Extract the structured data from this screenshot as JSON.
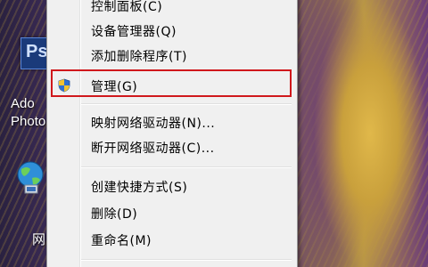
{
  "desktop": {
    "icons": [
      {
        "name": "photoshop",
        "label_line1": "Ado",
        "label_line2": "Photo",
        "glyph": "Ps"
      },
      {
        "name": "network",
        "label": "网"
      }
    ]
  },
  "context_menu": {
    "items": [
      {
        "label": "控制面板(C)",
        "icon": null
      },
      {
        "label": "设备管理器(Q)",
        "icon": null
      },
      {
        "label": "添加删除程序(T)",
        "icon": null
      },
      {
        "label": "管理(G)",
        "icon": "uac-shield-icon",
        "highlighted": true
      },
      {
        "label": "映射网络驱动器(N)...",
        "icon": null
      },
      {
        "label": "断开网络驱动器(C)...",
        "icon": null
      },
      {
        "label": "创建快捷方式(S)",
        "icon": null
      },
      {
        "label": "删除(D)",
        "icon": null
      },
      {
        "label": "重命名(M)",
        "icon": null
      }
    ],
    "highlight_color": "#d0181c"
  }
}
